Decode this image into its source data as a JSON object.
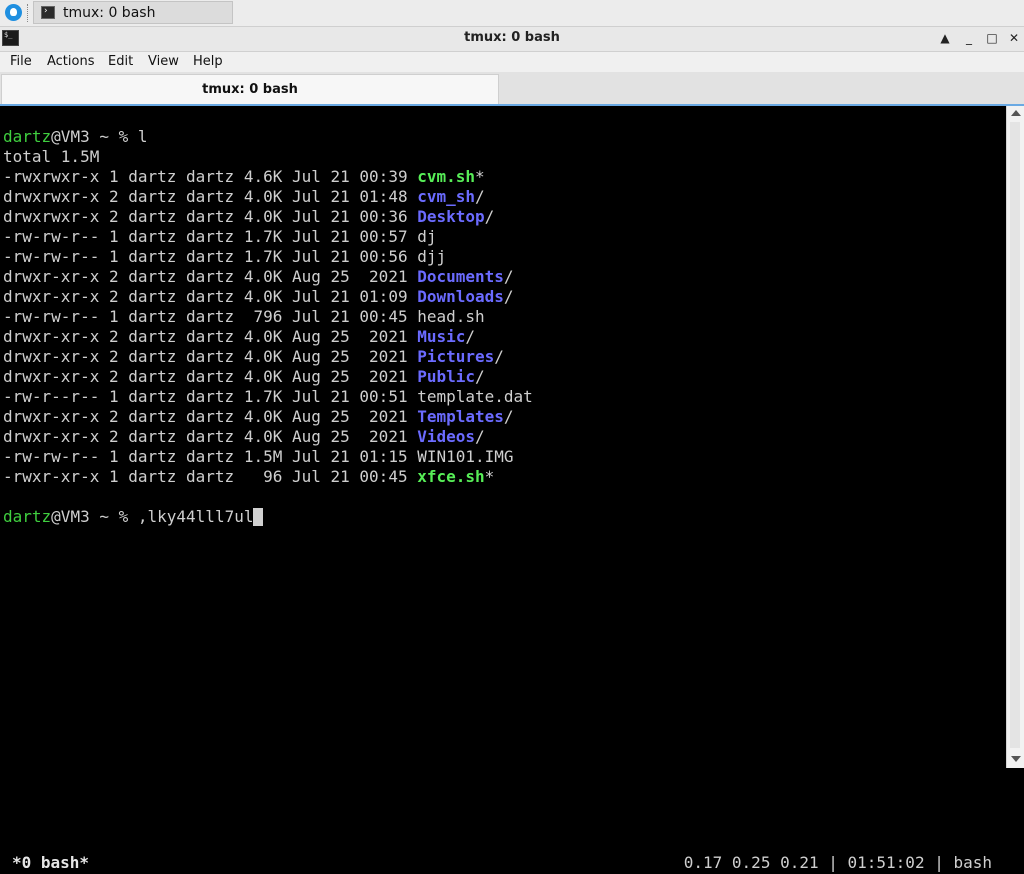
{
  "taskbar": {
    "start_icon": "app-menu-icon",
    "task_icon": "terminal-icon",
    "task_label": "tmux: 0 bash"
  },
  "window": {
    "title": "tmux: 0 bash",
    "icon": "terminal-icon",
    "buttons": {
      "up": "▲",
      "min": "_",
      "max": "□",
      "close": "✕"
    }
  },
  "menu": {
    "file": "File",
    "actions": "Actions",
    "edit": "Edit",
    "view": "View",
    "help": "Help"
  },
  "tabs": [
    {
      "label": "tmux: 0 bash"
    }
  ],
  "terminal": {
    "prompt1": {
      "user": "dartz",
      "host": "@VM3 ~ % ",
      "command": "l"
    },
    "total": "total 1.5M",
    "entries": [
      {
        "meta": "-rwxrwxr-x 1 dartz dartz 4.6K Jul 21 00:39 ",
        "name": "cvm.sh",
        "suffix": "*",
        "kind": "exec"
      },
      {
        "meta": "drwxrwxr-x 2 dartz dartz 4.0K Jul 21 01:48 ",
        "name": "cvm_sh",
        "suffix": "/",
        "kind": "dir"
      },
      {
        "meta": "drwxrwxr-x 2 dartz dartz 4.0K Jul 21 00:36 ",
        "name": "Desktop",
        "suffix": "/",
        "kind": "dir"
      },
      {
        "meta": "-rw-rw-r-- 1 dartz dartz 1.7K Jul 21 00:57 ",
        "name": "dj",
        "suffix": "",
        "kind": "file"
      },
      {
        "meta": "-rw-rw-r-- 1 dartz dartz 1.7K Jul 21 00:56 ",
        "name": "djj",
        "suffix": "",
        "kind": "file"
      },
      {
        "meta": "drwxr-xr-x 2 dartz dartz 4.0K Aug 25  2021 ",
        "name": "Documents",
        "suffix": "/",
        "kind": "dir"
      },
      {
        "meta": "drwxr-xr-x 2 dartz dartz 4.0K Jul 21 01:09 ",
        "name": "Downloads",
        "suffix": "/",
        "kind": "dir"
      },
      {
        "meta": "-rw-rw-r-- 1 dartz dartz  796 Jul 21 00:45 ",
        "name": "head.sh",
        "suffix": "",
        "kind": "file"
      },
      {
        "meta": "drwxr-xr-x 2 dartz dartz 4.0K Aug 25  2021 ",
        "name": "Music",
        "suffix": "/",
        "kind": "dir"
      },
      {
        "meta": "drwxr-xr-x 2 dartz dartz 4.0K Aug 25  2021 ",
        "name": "Pictures",
        "suffix": "/",
        "kind": "dir"
      },
      {
        "meta": "drwxr-xr-x 2 dartz dartz 4.0K Aug 25  2021 ",
        "name": "Public",
        "suffix": "/",
        "kind": "dir"
      },
      {
        "meta": "-rw-r--r-- 1 dartz dartz 1.7K Jul 21 00:51 ",
        "name": "template.dat",
        "suffix": "",
        "kind": "file"
      },
      {
        "meta": "drwxr-xr-x 2 dartz dartz 4.0K Aug 25  2021 ",
        "name": "Templates",
        "suffix": "/",
        "kind": "dir"
      },
      {
        "meta": "drwxr-xr-x 2 dartz dartz 4.0K Aug 25  2021 ",
        "name": "Videos",
        "suffix": "/",
        "kind": "dir"
      },
      {
        "meta": "-rw-rw-r-- 1 dartz dartz 1.5M Jul 21 01:15 ",
        "name": "WIN101.IMG",
        "suffix": "",
        "kind": "file"
      },
      {
        "meta": "-rwxr-xr-x 1 dartz dartz   96 Jul 21 00:45 ",
        "name": "xfce.sh",
        "suffix": "*",
        "kind": "exec"
      }
    ],
    "prompt2": {
      "user": "dartz",
      "host": "@VM3 ~ % ",
      "command": ",lky44lll7ul"
    }
  },
  "statusline": {
    "left": "*0 bash*",
    "right": "0.17 0.25 0.21 | 01:51:02 | bash"
  },
  "colors": {
    "prompt_user": "#3fcf3f",
    "exec": "#57ee57",
    "dir": "#6b6bff",
    "text": "#cfcfcf",
    "tab_accent": "#6aa9e3"
  }
}
